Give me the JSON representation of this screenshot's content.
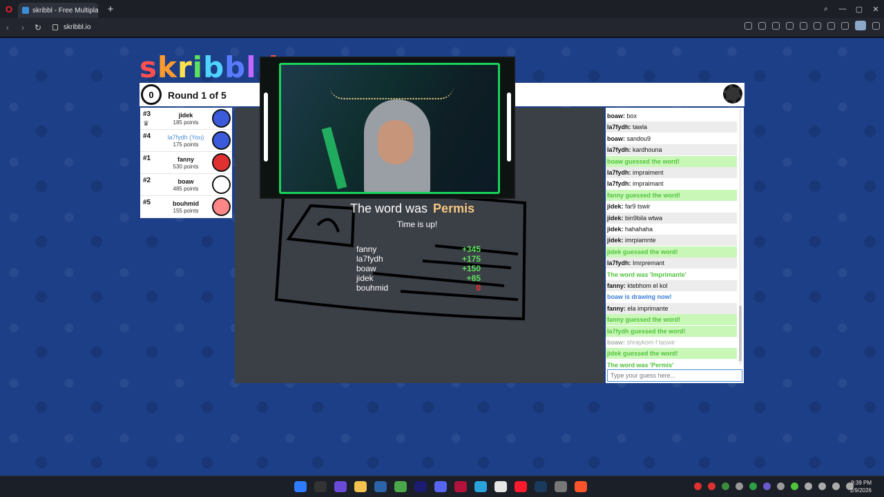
{
  "browser": {
    "tab_title": "skribbl - Free Multiplayer",
    "url": "skribbl.io"
  },
  "game": {
    "logo": "skribbl.i",
    "clock": "0",
    "round": "Round 1 of 5"
  },
  "players": [
    {
      "rank": "#3",
      "name": "jidek",
      "points": "185 points",
      "color": "#3b5bdb",
      "you": false
    },
    {
      "rank": "#4",
      "name": "la7fydh (You)",
      "points": "175 points",
      "color": "#3b5bdb",
      "you": true
    },
    {
      "rank": "#1",
      "name": "fanny",
      "points": "530 points",
      "color": "#e03131",
      "you": false
    },
    {
      "rank": "#2",
      "name": "boaw",
      "points": "485 points",
      "color": "#ffffff",
      "you": false
    },
    {
      "rank": "#5",
      "name": "bouhmid",
      "points": "155 points",
      "color": "#ff8787",
      "you": false
    }
  ],
  "result": {
    "word_prefix": "The word was",
    "word": "Permis",
    "time_up": "Time is up!",
    "scores": [
      {
        "name": "fanny",
        "delta": "+345"
      },
      {
        "name": "la7fydh",
        "delta": "+175"
      },
      {
        "name": "boaw",
        "delta": "+150"
      },
      {
        "name": "jidek",
        "delta": "+85"
      },
      {
        "name": "bouhmid",
        "delta": "0"
      }
    ]
  },
  "chat": {
    "messages": [
      {
        "user": "boaw:",
        "text": " box",
        "style": "normal"
      },
      {
        "user": "la7fydh:",
        "text": " tawla",
        "style": "alt"
      },
      {
        "user": "boaw:",
        "text": " sandou9",
        "style": "normal"
      },
      {
        "user": "la7fydh:",
        "text": " kardhouna",
        "style": "alt"
      },
      {
        "user": "",
        "text": "boaw guessed the word!",
        "style": "green"
      },
      {
        "user": "la7fydh:",
        "text": " impraiment",
        "style": "alt"
      },
      {
        "user": "la7fydh:",
        "text": " impraimant",
        "style": "normal"
      },
      {
        "user": "",
        "text": "fanny guessed the word!",
        "style": "green"
      },
      {
        "user": "jidek:",
        "text": " far9 tswir",
        "style": "normal"
      },
      {
        "user": "jidek:",
        "text": " bin9bila wtwa",
        "style": "alt"
      },
      {
        "user": "jidek:",
        "text": " hahahaha",
        "style": "normal"
      },
      {
        "user": "jidek:",
        "text": " imrpiamnte",
        "style": "alt"
      },
      {
        "user": "",
        "text": "jidek guessed the word!",
        "style": "green"
      },
      {
        "user": "la7fydh:",
        "text": " Imrpremant",
        "style": "alt"
      },
      {
        "user": "",
        "text": "The word was 'Imprimante'",
        "style": "greentext"
      },
      {
        "user": "fanny:",
        "text": " ktebhom el kol",
        "style": "alt"
      },
      {
        "user": "",
        "text": "boaw is drawing now!",
        "style": "blue"
      },
      {
        "user": "fanny:",
        "text": " ela imprimante",
        "style": "alt"
      },
      {
        "user": "",
        "text": "fanny guessed the word!",
        "style": "green"
      },
      {
        "user": "",
        "text": "la7fydh guessed the word!",
        "style": "green"
      },
      {
        "user": "boaw:",
        "text": " shraykom f taswir",
        "style": "gray"
      },
      {
        "user": "",
        "text": "jidek guessed the word!",
        "style": "green"
      },
      {
        "user": "",
        "text": "The word was 'Permis'",
        "style": "greentext"
      }
    ],
    "input_placeholder": "Type your guess here..."
  },
  "system": {
    "time": "9:39 PM",
    "date": "2/9/2026"
  }
}
